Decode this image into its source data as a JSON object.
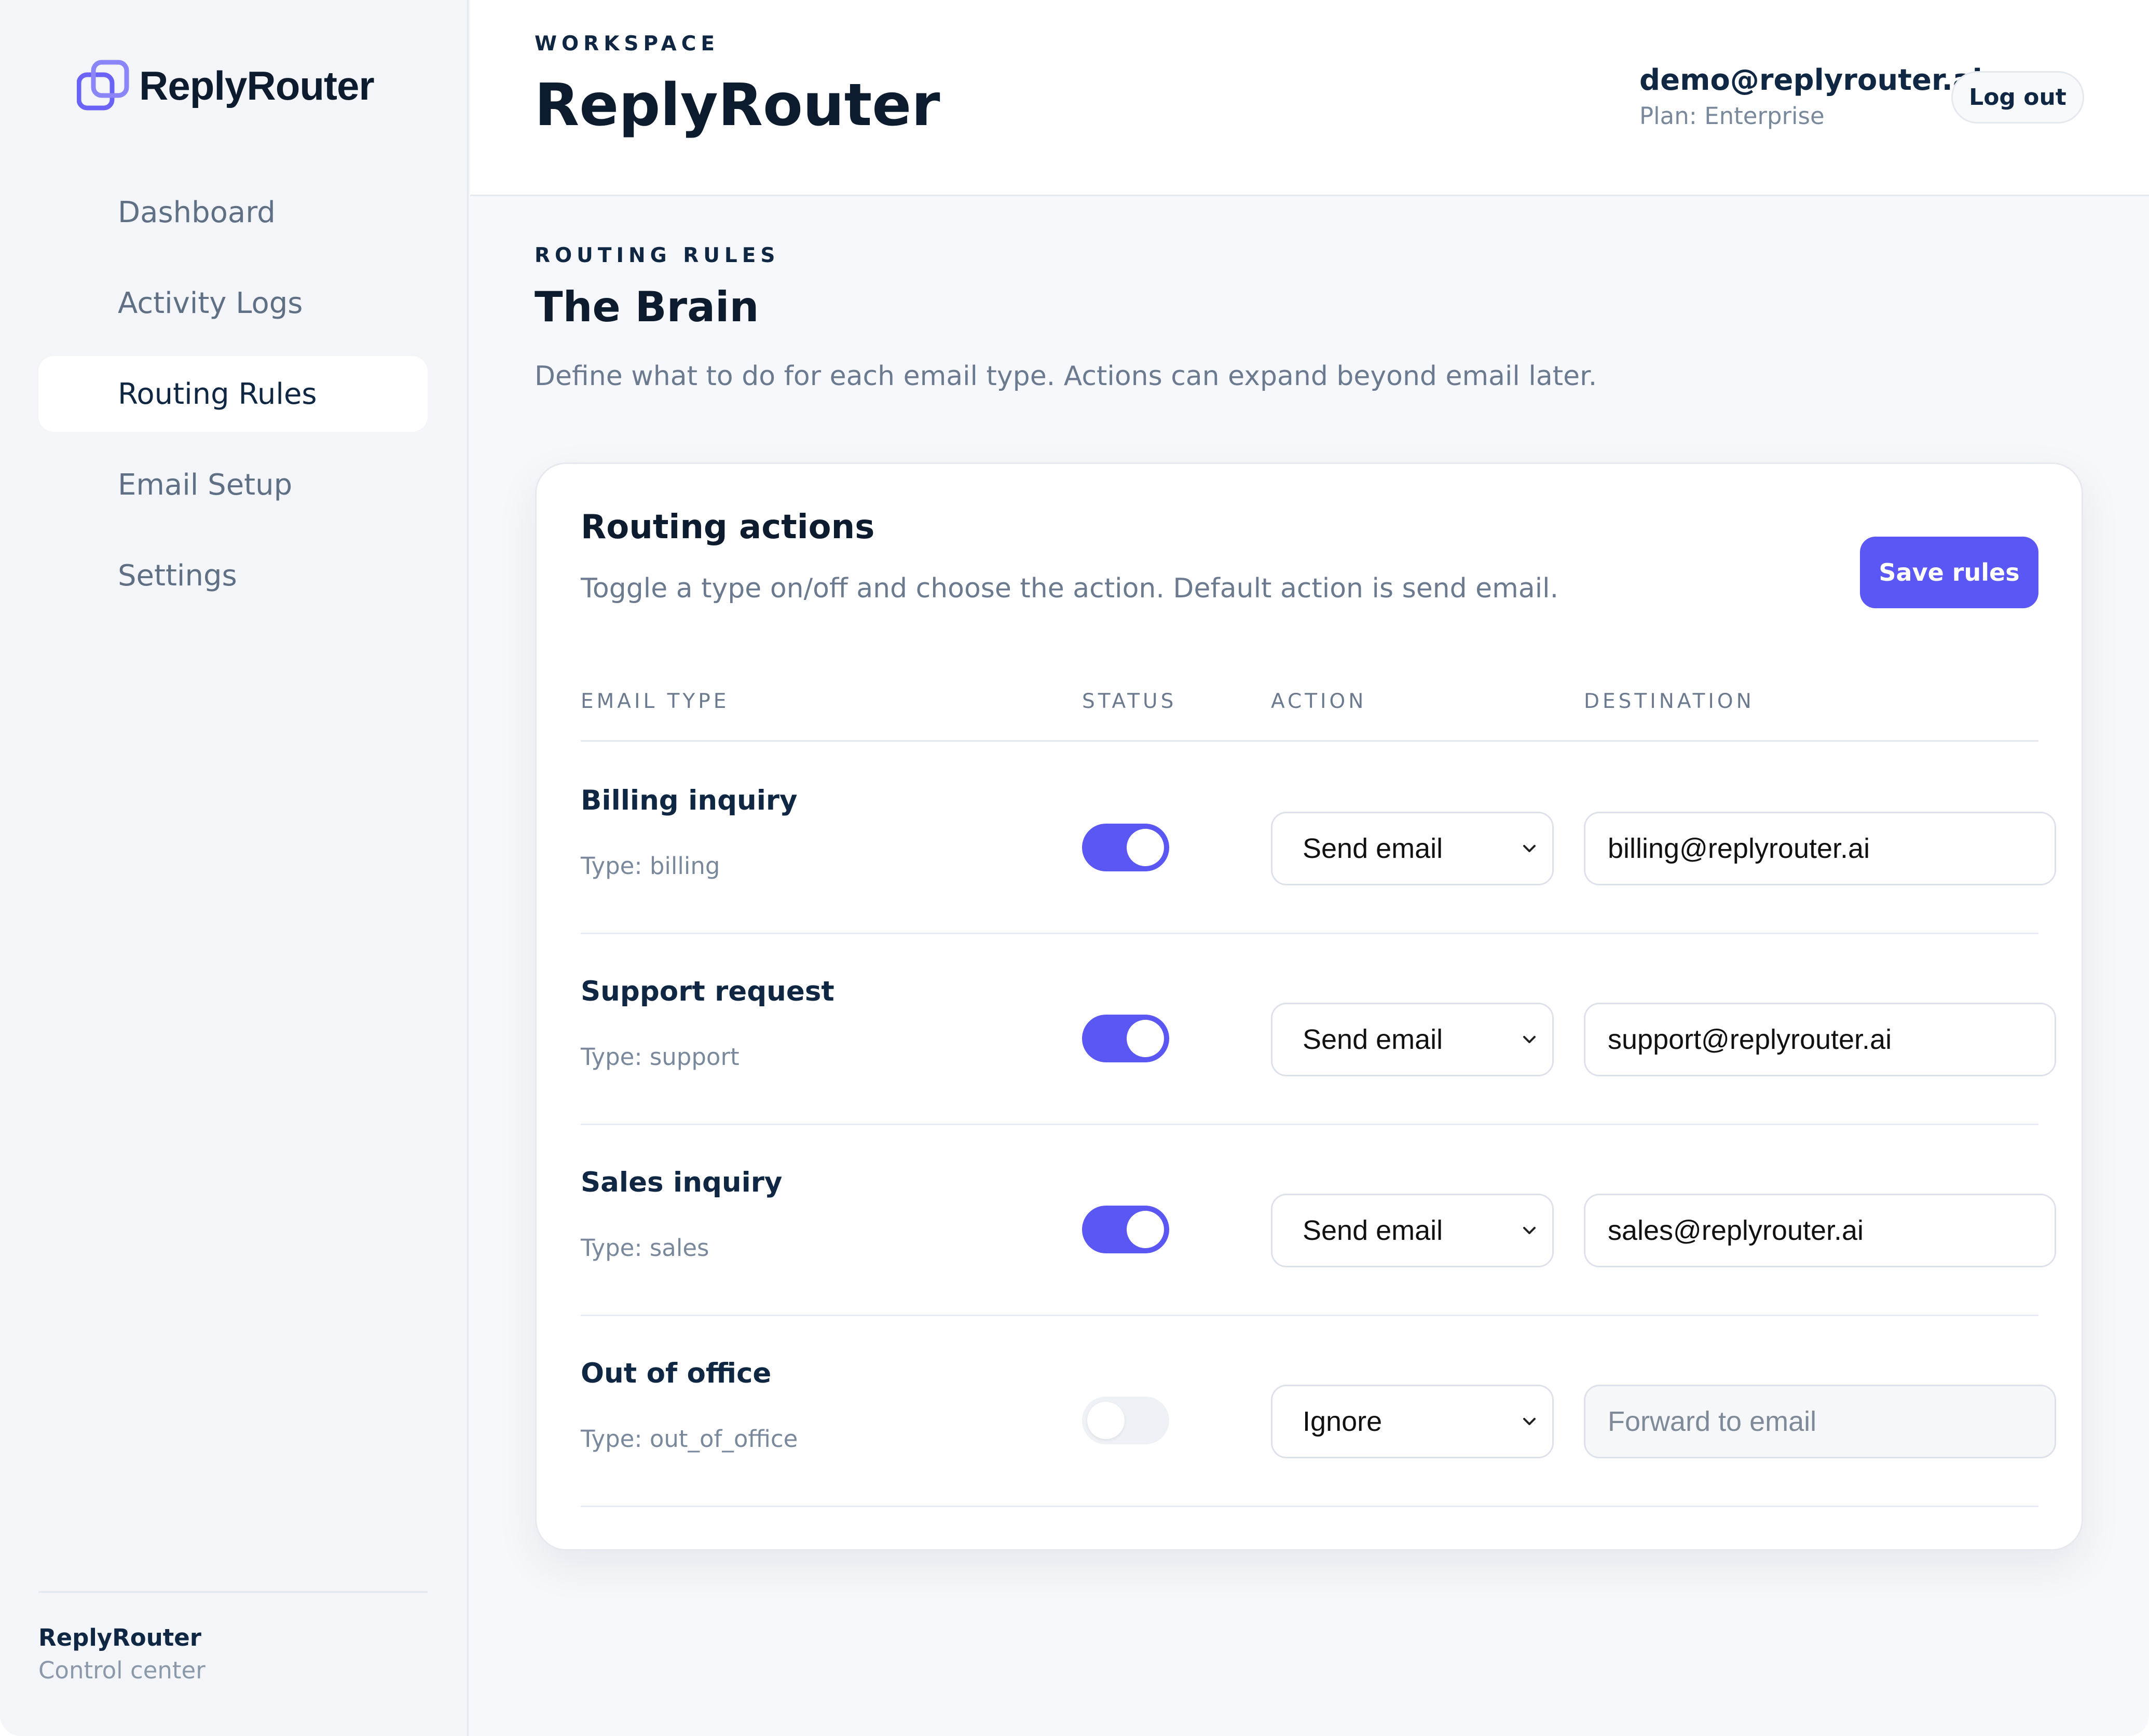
{
  "brand": {
    "name": "ReplyRouter"
  },
  "sidebar": {
    "items": [
      {
        "label": "Dashboard"
      },
      {
        "label": "Activity Logs"
      },
      {
        "label": "Routing Rules"
      },
      {
        "label": "Email Setup"
      },
      {
        "label": "Settings"
      }
    ],
    "footer": {
      "title": "ReplyRouter",
      "subtitle": "Control center"
    }
  },
  "header": {
    "eyebrow": "WORKSPACE",
    "title": "ReplyRouter",
    "user_email": "demo@replyrouter.ai",
    "plan": "Plan: Enterprise",
    "logout_label": "Log out"
  },
  "main": {
    "eyebrow": "ROUTING RULES",
    "title": "The Brain",
    "description": "Define what to do for each email type. Actions can expand beyond email later."
  },
  "card": {
    "title": "Routing actions",
    "description": "Toggle a type on/off and choose the action. Default action is send email.",
    "save_label": "Save rules",
    "columns": [
      "EMAIL TYPE",
      "STATUS",
      "ACTION",
      "DESTINATION"
    ],
    "rows": [
      {
        "name": "Billing inquiry",
        "type": "Type: billing",
        "enabled": true,
        "action": "Send email",
        "destination": "billing@replyrouter.ai",
        "placeholder": ""
      },
      {
        "name": "Support request",
        "type": "Type: support",
        "enabled": true,
        "action": "Send email",
        "destination": "support@replyrouter.ai",
        "placeholder": ""
      },
      {
        "name": "Sales inquiry",
        "type": "Type: sales",
        "enabled": true,
        "action": "Send email",
        "destination": "sales@replyrouter.ai",
        "placeholder": ""
      },
      {
        "name": "Out of office",
        "type": "Type: out_of_office",
        "enabled": false,
        "action": "Ignore",
        "destination": "",
        "placeholder": "Forward to email"
      }
    ]
  },
  "colors": {
    "accent": "#5b57f5",
    "text": "#0f2742",
    "muted": "#6b7a8e",
    "sidebar_bg": "#f3f5f9"
  }
}
